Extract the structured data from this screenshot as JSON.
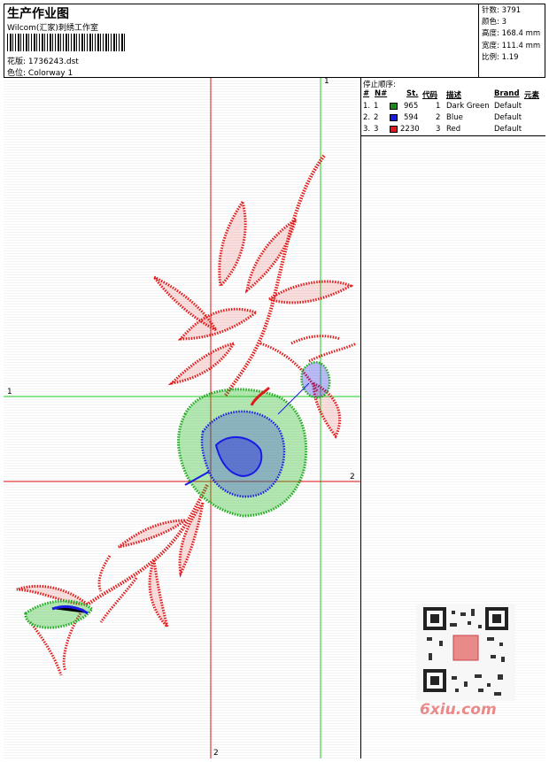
{
  "header": {
    "title": "生产作业图",
    "company": "Wilcom(汇家)刺绣工作室",
    "design_label": "花版:",
    "design_file": "1736243.dst",
    "colorway_label": "色位:",
    "colorway": "Colorway 1"
  },
  "stats": {
    "stitches_label": "针数:",
    "stitches": "3791",
    "colors_label": "颜色:",
    "colors": "3",
    "height_label": "高度:",
    "height": "168.4 mm",
    "width_label": "宽度:",
    "width": "111.4 mm",
    "scale_label": "比例:",
    "scale": "1.19"
  },
  "stop_sequence": {
    "title": "停止顺序:",
    "columns": [
      "#",
      "N#",
      "St.",
      "代码",
      "描述",
      "Brand",
      "元素"
    ],
    "rows": [
      {
        "idx": "1.",
        "n": "1",
        "st": "965",
        "code": "1",
        "desc": "Dark Green",
        "brand": "Default",
        "color": "#1a8a1a"
      },
      {
        "idx": "2.",
        "n": "2",
        "st": "594",
        "code": "2",
        "desc": "Blue",
        "brand": "Default",
        "color": "#1a1ae6"
      },
      {
        "idx": "3.",
        "n": "3",
        "st": "2230",
        "code": "3",
        "desc": "Red",
        "brand": "Default",
        "color": "#e01a1a"
      }
    ]
  },
  "guides": {
    "green_label": "1",
    "red_label": "2"
  },
  "watermark": "6xiu.com",
  "colors": {
    "green": "#22bb22",
    "red": "#dd1111",
    "blue": "#1111dd"
  }
}
